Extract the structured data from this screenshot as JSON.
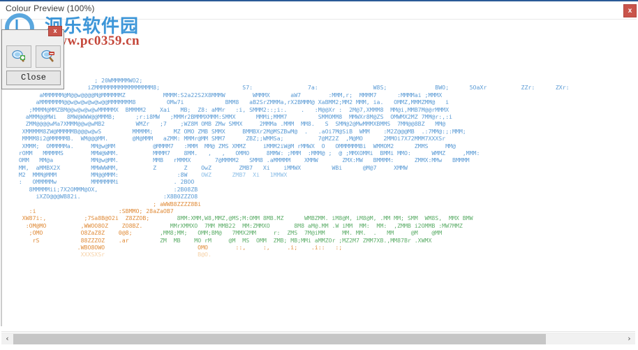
{
  "window": {
    "title": "Colour Preview (100%)",
    "close_label": "x"
  },
  "watermark": {
    "site_name": "洄乐软件园",
    "url": "www.pc0359.cn",
    "logo_icon": "circular-logo-icon"
  },
  "palette": {
    "close_badge_label": "x",
    "zoom_in_label": "",
    "zoom_in_icon": "magnifier-plus-icon",
    "zoom_out_label": "",
    "zoom_out_icon": "magnifier-minus-icon",
    "close_label": "Close"
  },
  "scrollbar": {
    "left_arrow": "‹",
    "right_arrow": "›"
  },
  "colors": {
    "accent_blue": "#5b9bd5",
    "accent_orange": "#e08c3a",
    "accent_green": "#5eae6a",
    "close_red": "#c9544b",
    "title_bar_line": "#2a5a96",
    "watermark_blue": "#2f8fd6",
    "watermark_red": "#c0392b",
    "scrollbar_thumb": "#c6c6c6"
  },
  "ascii_art": {
    "font": "monospace",
    "description": "ASCII-art colour preview render of a logo, composed of blue, orange and green character glyphs on white",
    "rows": [
      [
        {
          "t": "                        ; 20WMMMMMWO2;",
          "c": "c-blue"
        }
      ],
      [
        {
          "t": "                      iZMMMMMMMMMMMMMMMMM8;",
          "c": "c-blue"
        },
        {
          "t": "                        S7:                7a:                W8S;              BWO;      5OaXr          ZZr:      ZXr:",
          "c": "c-blue"
        }
      ],
      [
        {
          "t": "        aMMMMMM@M@@w@@@@M@MMMMMMZ",
          "c": "c-blue"
        },
        {
          "t": "           MMMM:S2a22S2X8MMMW        WMMMX      aW7        :MMM,r;  MMMM7      :MMMMai ;MMMX",
          "c": "c-blue"
        }
      ],
      [
        {
          "t": "       aMMMMMMM@@w@w@w@w@w@@MMMMMMM8",
          "c": "c-blue"
        },
        {
          "t": "         OMw7i            BMM8   aB2SrZMMMa,rX2BMMM@ XaBMM2;MM2 MMM, ia.   OMMZ,MMMZMM@   i",
          "c": "c-blue"
        }
      ],
      [
        {
          "t": "     ;MMMM@MMZBM@@w@w@w@wMMMMMX  BMMMM2",
          "c": "c-blue"
        },
        {
          "t": "    Xai   MB;  Z8: aMMr   :i, SMMM2::;i:.    .   :M@@Xr :  2M@7,XMMM8  MM@i,MMB7M@@rMMMX",
          "c": "c-blue"
        }
      ],
      [
        {
          "t": "    aMMM@@MWi   8MW@WWW@@MMMB;      ;r:i8MW",
          "c": "c-blue"
        },
        {
          "t": "   ;MMMr2BMMMXMMM:SMMX      MMMi;MMM7         SMMOMM8  MMWXr8M@ZS  OMWMX2MZ 7MM@r:,:i",
          "c": "c-blue"
        }
      ],
      [
        {
          "t": "    ZMM@@@@wMa7XMMM@@w@wMB2         WMZr   ;7",
          "c": "c-blue"
        },
        {
          "t": "    ;WZ8M OMB ZMw SMMX     2MMMa .MMM  MM8.   S  SMM@2@MwMMMXBMMS  7MM@@8BZ   MM@",
          "c": "c-blue"
        }
      ],
      [
        {
          "t": "   XMMMMM8ZW@MMMMMB@@@w@wS         MMMMM;",
          "c": "c-blue"
        },
        {
          "t": "      MZ OMO ZMB SMMX     BMMBXr2M@MSZBwM@  .   .aOi7M@SiB  WMM    :M2Z@@@MB  .:7MM@:;:MMM;",
          "c": "c-blue"
        }
      ],
      [
        {
          "t": "   MMMM8i2@MMMMMB.  WM@@@MM.       @M@MMM",
          "c": "c-blue"
        },
        {
          "t": "   aZMM: MMMr@MM SMM7      ZBZ;;WMMSa;          7@MZ2Z  ,M@MO      2MMOi7X72MMM7XXXSr",
          "c": "c-blue"
        }
      ],
      [
        {
          "t": "   XMMM;  OMMMMMa.     MM@w@MM           @MMMM7",
          "c": "c-blue"
        },
        {
          "t": "   :MMM  MM@ ZMS XMMZ     iMMM2iW@M rMMWX  O   OMMMMMMBi  WMMOM2      ZMMS     MM@",
          "c": "c-blue"
        }
      ],
      [
        {
          "t": "  rOMM   MMMMMS        MMW@WMM.          MMMM7",
          "c": "c-blue"
        },
        {
          "t": "    8MM.   ,   ,   OMMO     8MMW: ;MMM  :MMM@ ;  @ ;MMXOMMi  BMMi MMO:      WMMZ     ,MMM:",
          "c": "c-blue"
        }
      ],
      [
        {
          "t": "  OMM   MM@a           MM@w@MM.          MMB",
          "c": "c-blue"
        },
        {
          "t": "   rMMMX       7@MMMM2   SMM8 .aMMMMM    XMMW       ZMX:MW   BMMMM:      ZMMX:MMw   BMMMM",
          "c": "c-blue"
        }
      ],
      [
        {
          "t": "  MM,  aMMBX2X         MMWWWMM,          Z        Z",
          "c": "c-blue"
        },
        {
          "t": "    OwZ        ZMB7   Xi    iMMWX         WBi      @M@7     XMMW",
          "c": "c-blue"
        }
      ],
      [
        {
          "t": "  M2  MMM@MMM          MM@@MMM:                 :8W",
          "c": "c-blue"
        },
        {
          "t": "    OWZ      ZMB7  Xi   1MMWX",
          "c": "c-blue2"
        }
      ],
      [
        {
          "t": "  :   OMMMMMw          MMMMMMMi                . 2BOO",
          "c": "c-blue"
        }
      ],
      [
        {
          "t": "     8MMMMMii;7X2OMMM@OX,                      :2B08ZB",
          "c": "c-blue"
        }
      ],
      [
        {
          "t": "       iXZO@@@WB82i.                        :X8B0ZZZO8",
          "c": "c-blue"
        }
      ],
      [
        {
          "t": "                                         ; aWWB8ZZZZ8Bi",
          "c": "c-orange"
        }
      ],
      [
        {
          "t": "     :i                        :SBMMO; 28aZaOB7",
          "c": "c-orange"
        }
      ],
      [
        {
          "t": "   XW87i:,           ;7Sa8B@O2i  Z8ZZOB;",
          "c": "c-orange"
        },
        {
          "t": "        8MM:XMM,W8,MMZ,@MS;M:OMM 8MB.MZ      WMBZMM. iM8@M, iM8@M, .MM MM; SMM  WM8S,  MMX BMW",
          "c": "c-green"
        }
      ],
      [
        {
          "t": "    :OM@MO          ,WWOO8OZ    ZO8BZ.",
          "c": "c-orange"
        },
        {
          "t": "        MMrXMMXO  7MM MMB22  MM:ZMMXO       8M8 aM@.MM .W iMM  MM:  MM:  ,ZMMB i2OMMB :MW7MMZ",
          "c": "c-green"
        }
      ],
      [
        {
          "t": "     ;OMO           O8ZaZ8Z    0@8;",
          "c": "c-orange"
        },
        {
          "t": "        ,MM8;MM;   OMM;BM@   7MMX2MM     r:  ZMS  7M@iMM     MM. MM.  .   MM     @M    @MM",
          "c": "c-green"
        }
      ],
      [
        {
          "t": "      rS            88ZZZOZ    .ar",
          "c": "c-orange"
        },
        {
          "t": "         ZM  MB    MO rM     @M  MS  OMM  ZMB; MB;MMi aMMZOr ;MZ2M7 ZMM7XB.,MM87Br .XWMX",
          "c": "c-green"
        }
      ],
      [
        {
          "t": "                   .WBO8OWO                           OMO        ::,     :,     .i;    .i::   :;",
          "c": "c-orange"
        }
      ],
      [
        {
          "t": "                    XXXSXSr                           B@O.",
          "c": "c-orglt"
        }
      ]
    ]
  }
}
